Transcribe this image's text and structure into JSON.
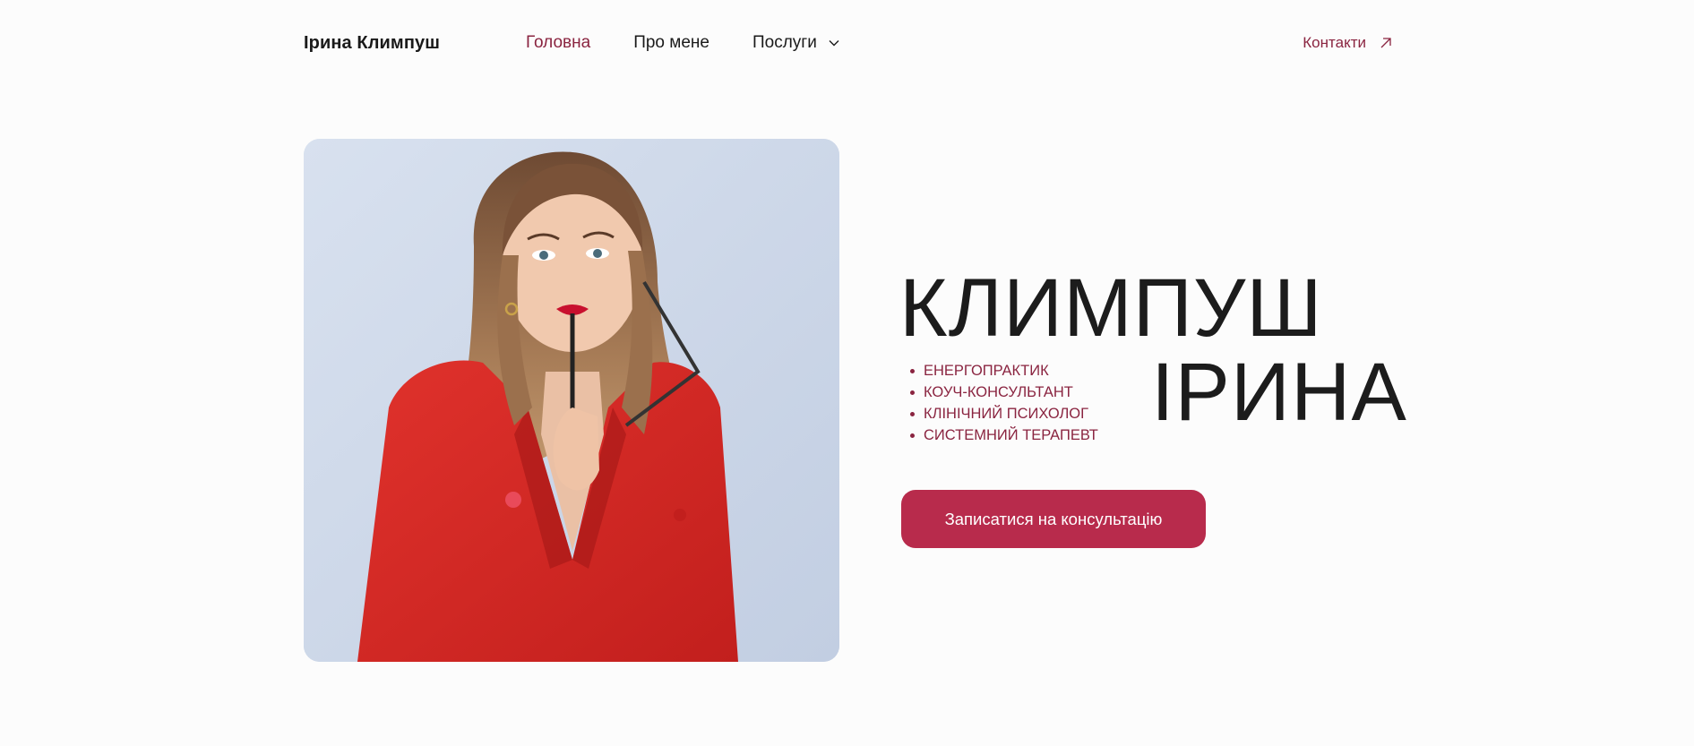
{
  "header": {
    "logo": "Ірина Климпуш",
    "nav": {
      "home": "Головна",
      "about": "Про мене",
      "services": "Послуги"
    },
    "contacts": "Контакти"
  },
  "hero": {
    "title_line1": "КЛИМПУШ",
    "title_line2": "ІРИНА",
    "roles": [
      "ЕНЕРГОПРАКТИК",
      "КОУЧ-КОНСУЛЬТАНТ",
      "КЛІНІЧНИЙ ПСИХОЛОГ",
      "СИСТЕМНИЙ ТЕРАПЕВТ"
    ],
    "cta": "Записатися на консультацію"
  },
  "colors": {
    "accent": "#8a2440",
    "button": "#b82b4c",
    "background": "#fcfcfc",
    "text": "#1a1a1a",
    "photo_background": "#cfd9ea"
  },
  "icons": {
    "services_dropdown": "chevron-down-icon",
    "contacts_link": "arrow-up-right-icon"
  }
}
